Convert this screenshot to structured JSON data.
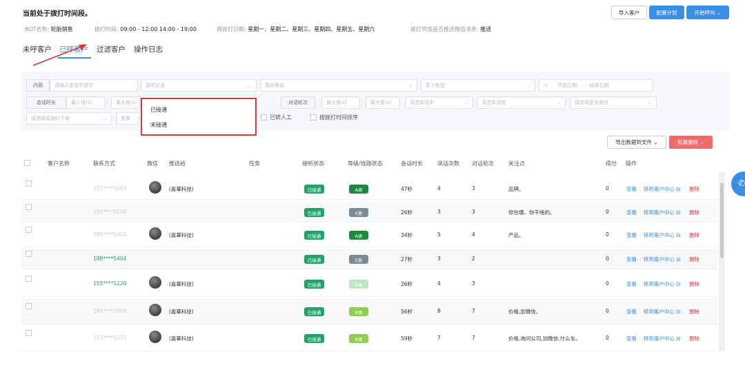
{
  "header": {
    "notice": "当前处于拨打时间段。",
    "buttons": {
      "import": "导入客户",
      "config": "配置计划",
      "start": "开始呼叫 ⌄"
    },
    "info": {
      "bot_label": "BOT名称:",
      "bot_value": "轮胎销售",
      "time_label": "拨打时段:",
      "time_value": "09:00 - 12:00 14:00 - 19:00",
      "day_label": "周拨打日期:",
      "day_value": "星期一、星期二、星期三、星期四、星期五、星期六",
      "wechat_label": "拨打完成是否推送微信消息:",
      "wechat_value": "推送"
    }
  },
  "tabs": [
    "未呼客户",
    "已呼客户",
    "过滤客户",
    "操作日志"
  ],
  "filters": {
    "content_prefix": "内容",
    "content_placeholder": "请输入查询关键字",
    "answer_status_placeholder": "接听状态",
    "grade_placeholder": "意向等级",
    "tag_placeholder": "意义标签",
    "start_date": "开始日期",
    "end_date": "结束日期",
    "duration_prefix": "会话时长",
    "min": "最小值(s)",
    "max": "最大值(s)",
    "rounds_prefix": "对话轮次",
    "min_rounds": "最小值(s)",
    "max_rounds": "最大值(s)",
    "select_script": "请选择话术",
    "select_flow": "请选择流程",
    "select_wechat": "请选择更多微信",
    "select_dept": "请选择营销的下级",
    "view_prefix": "查看",
    "transfer": "已转人工",
    "sort": "按拨打时间排序"
  },
  "dropdown": {
    "options": [
      "已接通",
      "未接通"
    ]
  },
  "toolbar": {
    "export": "导出数据到文件 ⌄",
    "batch_delete": "批量删除 ⌄"
  },
  "table": {
    "headers": [
      "客户名称",
      "联系方式",
      "微信",
      "推送给",
      "任务",
      "接听状态",
      "等级/线路状态",
      "会话时长",
      "说话次数",
      "对话轮次",
      "关注点",
      "得分",
      "操作"
    ],
    "rows": [
      {
        "phone": "151****5683",
        "avatar": true,
        "push": "(嘉華科技)",
        "status": "已接通",
        "grade": "A类",
        "gcls": "A",
        "dur": "47秒",
        "talks": "4",
        "rounds": "3",
        "focus": "品牌。",
        "score": "0",
        "pcls": "phone-dim"
      },
      {
        "phone": "155****0136",
        "avatar": false,
        "push": "",
        "status": "已接通",
        "grade": "E类",
        "gcls": "E",
        "dur": "26秒",
        "talks": "3",
        "rounds": "3",
        "focus": "你在哪、你干啥的。",
        "score": "0",
        "pcls": "phone-dim"
      },
      {
        "phone": "188****5404",
        "avatar": true,
        "push": "(嘉華科技)",
        "status": "已接通",
        "grade": "A类",
        "gcls": "A",
        "dur": "34秒",
        "talks": "5",
        "rounds": "4",
        "focus": "产品。",
        "score": "0",
        "pcls": "phone-dim"
      },
      {
        "phone": "188****5404",
        "avatar": false,
        "push": "",
        "status": "已接通",
        "grade": "E类",
        "gcls": "E",
        "dur": "27秒",
        "talks": "3",
        "rounds": "2",
        "focus": "",
        "score": "0",
        "pcls": "phone-green"
      },
      {
        "phone": "155****1220",
        "avatar": true,
        "push": "(嘉華科技)",
        "status": "已接通",
        "grade": "D类",
        "gcls": "D",
        "dur": "26秒",
        "talks": "4",
        "rounds": "3",
        "focus": "",
        "score": "0",
        "pcls": "phone-green"
      },
      {
        "phone": "186****7888",
        "avatar": true,
        "push": "(嘉華科技)",
        "status": "已接通",
        "grade": "B类",
        "gcls": "B",
        "dur": "56秒",
        "talks": "8",
        "rounds": "7",
        "focus": "价格,加微信。",
        "score": "0",
        "pcls": "phone-dim"
      },
      {
        "phone": "153****5075",
        "avatar": true,
        "push": "(嘉華科技)",
        "status": "已接通",
        "grade": "B类",
        "gcls": "B",
        "dur": "59秒",
        "talks": "7",
        "rounds": "7",
        "focus": "价格,询问公司,加微信,什么车。",
        "score": "0",
        "pcls": "phone-dim"
      }
    ],
    "ops": {
      "view": "查看",
      "move": "移到客户中心 ⊟",
      "delete": "删除"
    }
  }
}
